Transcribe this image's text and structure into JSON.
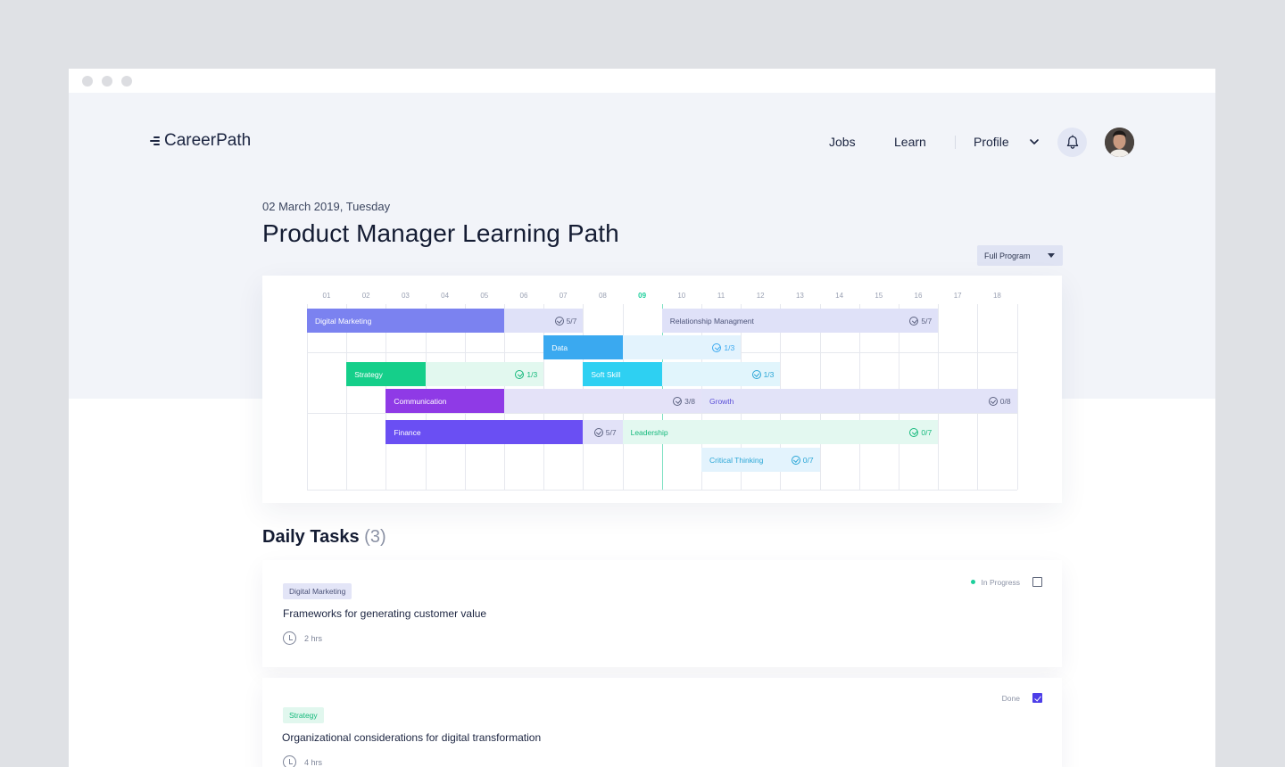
{
  "window": {
    "controls": [
      "close",
      "minimize",
      "maximize"
    ]
  },
  "header": {
    "logo_text": "CareerPath",
    "nav": {
      "jobs": "Jobs",
      "learn": "Learn",
      "profile": "Profile"
    },
    "icons": {
      "menu": "chevron-down-icon",
      "notifications": "bell-icon",
      "avatar": "user-avatar"
    }
  },
  "page": {
    "date": "02 March 2019, Tuesday",
    "title": "Product Manager Learning Path",
    "program_select": "Full Program"
  },
  "gantt": {
    "current_column": "09",
    "columns": [
      "01",
      "02",
      "03",
      "04",
      "05",
      "06",
      "07",
      "08",
      "09",
      "10",
      "11",
      "12",
      "13",
      "14",
      "15",
      "16",
      "17",
      "18"
    ],
    "tasks": [
      {
        "name": "Digital Marketing",
        "start": 1,
        "done_end": 5,
        "end": 7,
        "row": 0,
        "progress": "5/7",
        "color": "#7b82f0",
        "track": "#dfe1f8",
        "text": "#ffffff",
        "count_color": "#5d6382"
      },
      {
        "name": "Relationship Managment",
        "start": 10,
        "done_end": 9,
        "end": 16,
        "row": 0,
        "progress": "5/7",
        "color": "#dfe1f8",
        "track": "#dfe1f8",
        "text": "#4b5278",
        "count_color": "#5d6382"
      },
      {
        "name": "Data",
        "start": 7,
        "done_end": 8,
        "end": 11,
        "row": 1,
        "progress": "1/3",
        "color": "#3aa9f0",
        "track": "#e3f3fd",
        "text": "#ffffff",
        "count_color": "#3aa9f0"
      },
      {
        "name": "Strategy",
        "start": 2,
        "done_end": 3,
        "end": 6,
        "row": 2,
        "progress": "1/3",
        "color": "#15cf8a",
        "track": "#e2f8ef",
        "text": "#ffffff",
        "count_color": "#15b97c"
      },
      {
        "name": "Soft Skill",
        "start": 8,
        "done_end": 9,
        "end": 12,
        "row": 2,
        "progress": "1/3",
        "color": "#2ed0f2",
        "track": "#e1f5fc",
        "text": "#ffffff",
        "count_color": "#2aa6d6"
      },
      {
        "name": "Communication",
        "start": 3,
        "done_end": 5,
        "end": 10,
        "row": 3,
        "progress": "3/8",
        "color": "#8f3ae6",
        "track": "#e4e2f8",
        "text": "#ffffff",
        "count_color": "#5d6382"
      },
      {
        "name": "Growth",
        "start": 11,
        "done_end": 10,
        "end": 18,
        "row": 3,
        "progress": "0/8",
        "color": "#e2e3f8",
        "track": "#e2e3f8",
        "text": "#5b4fd8",
        "count_color": "#5d6382"
      },
      {
        "name": "Finance",
        "start": 3,
        "done_end": 7,
        "end": 8,
        "row": 4,
        "progress": "5/7",
        "color": "#6a4ff3",
        "track": "#e2e2f8",
        "text": "#ffffff",
        "count_color": "#5d6382"
      },
      {
        "name": "Leadership",
        "start": 9,
        "done_end": 8,
        "end": 16,
        "row": 4,
        "progress": "0/7",
        "color": "#e3f8f0",
        "track": "#e3f8f0",
        "text": "#15b97c",
        "count_color": "#15b97c"
      },
      {
        "name": "Critical Thinking",
        "start": 11,
        "done_end": 10,
        "end": 13,
        "row": 5,
        "progress": "0/7",
        "color": "#e3f3fd",
        "track": "#e3f3fd",
        "text": "#2aa6d6",
        "count_color": "#2aa6d6"
      }
    ]
  },
  "daily_tasks": {
    "title": "Daily Tasks",
    "count": "(3)",
    "items": [
      {
        "tag": "Digital Marketing",
        "tag_bg": "#e3e5f7",
        "tag_color": "#4b5278",
        "title": "Frameworks for generating customer value",
        "duration": "2 hrs",
        "status": "In Progress",
        "checked": false
      },
      {
        "tag": "Strategy",
        "tag_bg": "#e1f7ee",
        "tag_color": "#15b97c",
        "title": "Organizational considerations for digital transformation",
        "duration": "4 hrs",
        "status": "Done",
        "checked": true
      }
    ]
  }
}
